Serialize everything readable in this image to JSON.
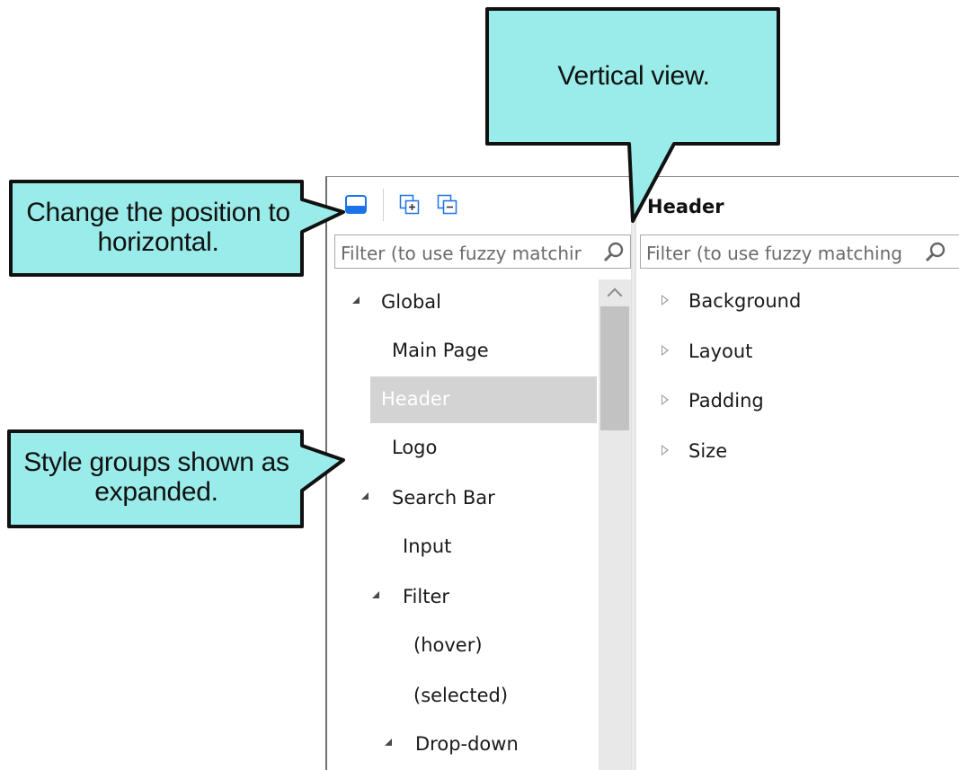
{
  "callouts": {
    "vertical": "Vertical view.",
    "position": "Change the position to horizontal.",
    "expanded": "Style groups shown as expanded."
  },
  "toolbar": {
    "layout_icon": "layout-toggle-icon",
    "expand_icon": "expand-all-icon",
    "collapse_icon": "collapse-all-icon"
  },
  "left_filter": {
    "placeholder": "Filter (to use fuzzy matchir"
  },
  "right_filter": {
    "placeholder": "Filter (to use fuzzy matching"
  },
  "right_title": "Header",
  "tree": [
    {
      "label": "Global",
      "expanded": true
    },
    {
      "label": "Main Page"
    },
    {
      "label": "Header",
      "expanded": true,
      "selected": true
    },
    {
      "label": "Logo"
    },
    {
      "label": "Search Bar",
      "expanded": true
    },
    {
      "label": "Input"
    },
    {
      "label": "Filter",
      "expanded": true
    },
    {
      "label": "(hover)"
    },
    {
      "label": "(selected)"
    },
    {
      "label": "Drop-down",
      "expanded": true
    }
  ],
  "properties": [
    "Background",
    "Layout",
    "Padding",
    "Size"
  ],
  "colors": {
    "callout_fill": "#99ece9",
    "callout_stroke": "#111111",
    "selection": "#d3d3d3",
    "icon_blue": "#1a73e8"
  }
}
